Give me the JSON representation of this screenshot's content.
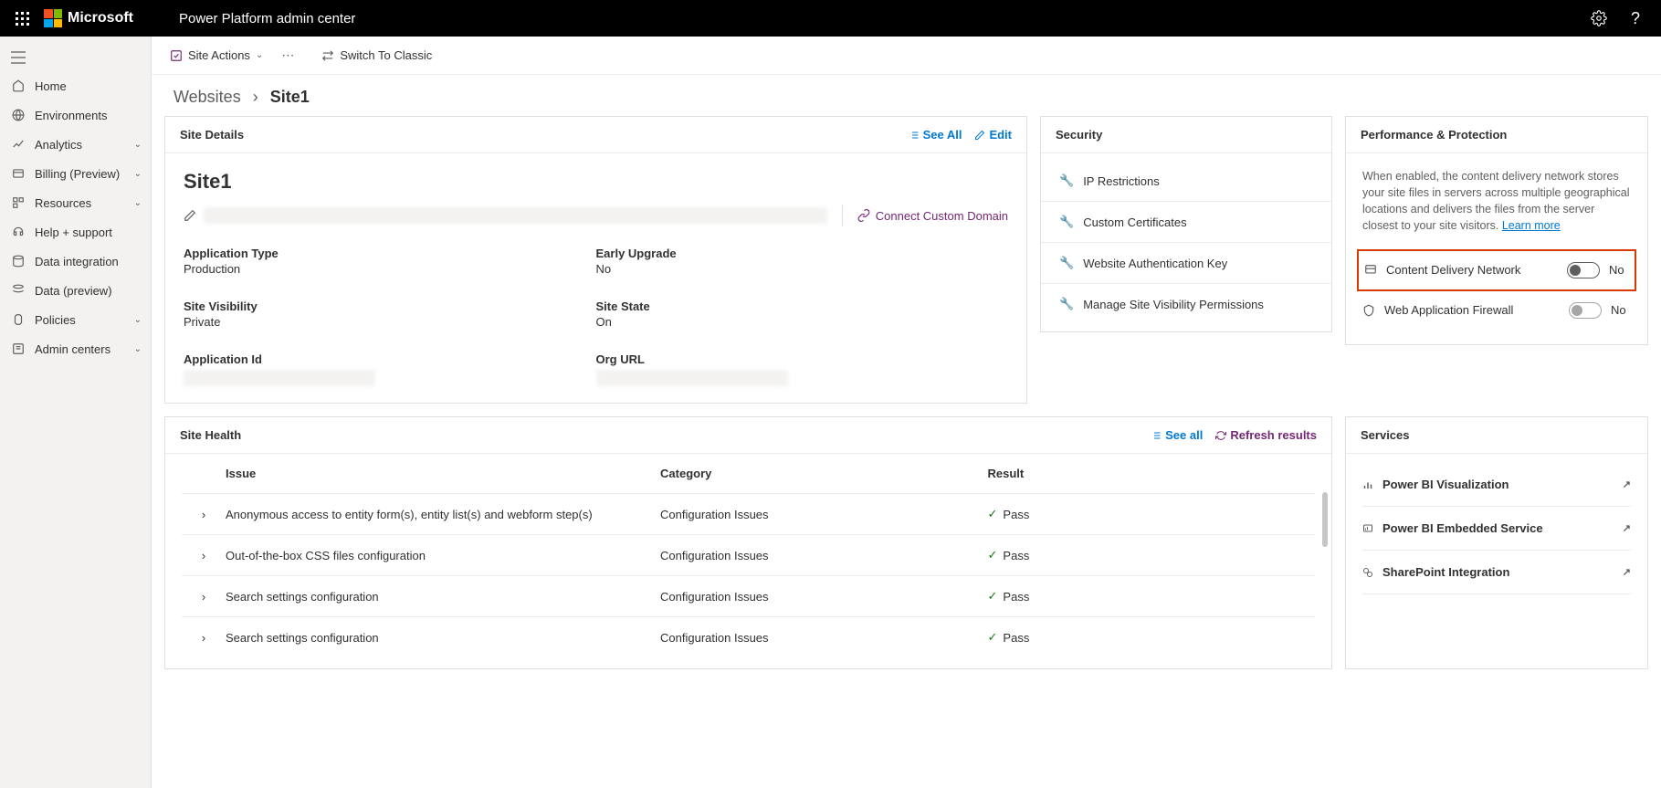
{
  "top": {
    "ms_text": "Microsoft",
    "app_title": "Power Platform admin center"
  },
  "nav": {
    "home": "Home",
    "environments": "Environments",
    "analytics": "Analytics",
    "billing": "Billing (Preview)",
    "resources": "Resources",
    "help": "Help + support",
    "data_integration": "Data integration",
    "data_preview": "Data (preview)",
    "policies": "Policies",
    "admin_centers": "Admin centers"
  },
  "cmd": {
    "site_actions": "Site Actions",
    "switch_classic": "Switch To Classic"
  },
  "breadcrumb": {
    "parent": "Websites",
    "current": "Site1"
  },
  "site_details": {
    "title": "Site Details",
    "see_all": "See All",
    "edit": "Edit",
    "name": "Site1",
    "connect_domain": "Connect Custom Domain",
    "fields": {
      "app_type_label": "Application Type",
      "app_type_value": "Production",
      "early_upgrade_label": "Early Upgrade",
      "early_upgrade_value": "No",
      "visibility_label": "Site Visibility",
      "visibility_value": "Private",
      "state_label": "Site State",
      "state_value": "On",
      "app_id_label": "Application Id",
      "org_url_label": "Org URL"
    }
  },
  "security": {
    "title": "Security",
    "items": [
      "IP Restrictions",
      "Custom Certificates",
      "Website Authentication Key",
      "Manage Site Visibility Permissions"
    ]
  },
  "perf": {
    "title": "Performance & Protection",
    "desc": "When enabled, the content delivery network stores your site files in servers across multiple geographical locations and delivers the files from the server closest to your site visitors. ",
    "learn_more": "Learn more",
    "cdn": {
      "label": "Content Delivery Network",
      "state": "No"
    },
    "waf": {
      "label": "Web Application Firewall",
      "state": "No"
    }
  },
  "health": {
    "title": "Site Health",
    "see_all": "See all",
    "refresh": "Refresh results",
    "cols": {
      "issue": "Issue",
      "category": "Category",
      "result": "Result"
    },
    "rows": [
      {
        "issue": "Anonymous access to entity form(s), entity list(s) and webform step(s)",
        "category": "Configuration Issues",
        "result": "Pass"
      },
      {
        "issue": "Out-of-the-box CSS files configuration",
        "category": "Configuration Issues",
        "result": "Pass"
      },
      {
        "issue": "Search settings configuration",
        "category": "Configuration Issues",
        "result": "Pass"
      },
      {
        "issue": "Search settings configuration",
        "category": "Configuration Issues",
        "result": "Pass"
      }
    ]
  },
  "services": {
    "title": "Services",
    "items": [
      "Power BI Visualization",
      "Power BI Embedded Service",
      "SharePoint Integration"
    ]
  }
}
